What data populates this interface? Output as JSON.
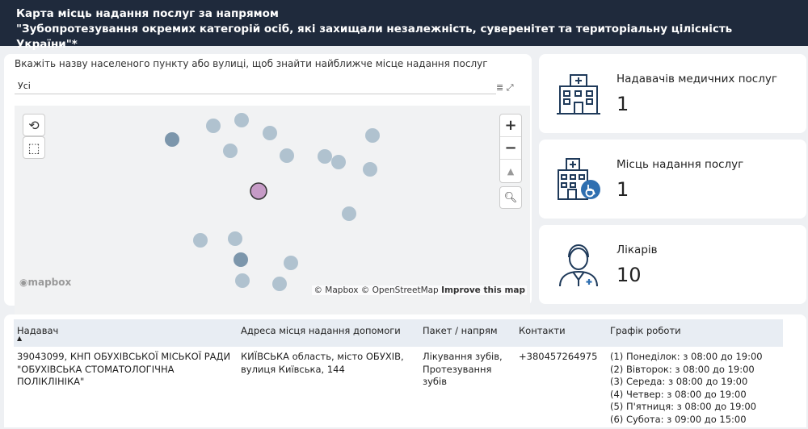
{
  "header": {
    "line1": "Карта місць надання послуг за напрямом",
    "line2": "\"Зубопротезування окремих категорій осіб, які захищали незалежність, суверенітет та територіальну цілісність України\"*"
  },
  "search": {
    "label": "Вкажіть назву населеного пункту або вулиці, щоб знайти найближче місце надання послуг",
    "value": "Усі"
  },
  "map": {
    "logo": "mapbox",
    "attribution_mapbox": "© Mapbox",
    "attribution_osm": "© OpenStreetMap",
    "improve": "Improve this map",
    "colors": {
      "point": "#a8bccb",
      "point_dark": "#6f8ca3",
      "selected": "#c69bc6"
    }
  },
  "stats": [
    {
      "icon": "hospital-icon",
      "label": "Надавачів медичних послуг",
      "value": "1"
    },
    {
      "icon": "clinic-wheelchair-icon",
      "label": "Місць надання послуг",
      "value": "1"
    },
    {
      "icon": "doctor-icon",
      "label": "Лікарів",
      "value": "10"
    }
  ],
  "table": {
    "headers": [
      "Надавач",
      "Адреса місця надання допомоги",
      "Пакет / напрям",
      "Контакти",
      "Графік роботи"
    ],
    "rows": [
      {
        "provider": "39043099, КНП ОБУХІВСЬКОЇ МІСЬКОЇ РАДИ \"ОБУХІВСЬКА СТОМАТОЛОГІЧНА ПОЛІКЛІНІКА\"",
        "address": "КИЇВСЬКА область, місто ОБУХІВ, вулиця Київська, 144",
        "package": "Лікування зубів, Протезування зубів",
        "contacts": "+380457264975",
        "schedule": [
          "(1) Понеділок: з 08:00 до 19:00",
          "(2) Вівторок: з 08:00 до 19:00",
          "(3) Середа: з 08:00 до 19:00",
          "(4) Четвер: з 08:00 до 19:00",
          "(5) П'ятниця: з 08:00 до 19:00",
          "(6) Субота: з 09:00 до 15:00"
        ]
      }
    ]
  }
}
